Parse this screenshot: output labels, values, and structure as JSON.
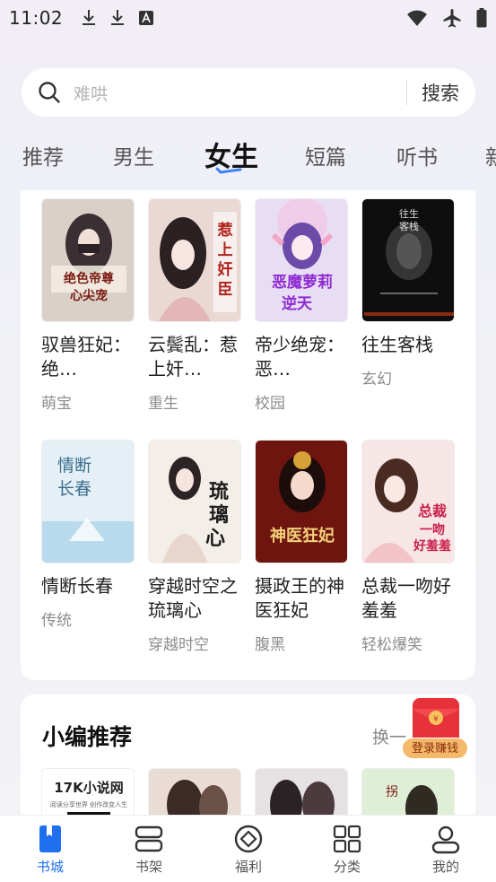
{
  "status_bar": {
    "time": "11:02",
    "left_icons": [
      "download-icon",
      "download-icon",
      "translate-icon"
    ],
    "right_icons": [
      "wifi-icon",
      "airplane-icon",
      "battery-icon"
    ]
  },
  "search": {
    "placeholder": "难哄",
    "button_label": "搜索"
  },
  "tabs": [
    {
      "label": "推荐",
      "active": false
    },
    {
      "label": "男生",
      "active": false
    },
    {
      "label": "女生",
      "active": true
    },
    {
      "label": "短篇",
      "active": false
    },
    {
      "label": "听书",
      "active": false
    },
    {
      "label": "新",
      "active": false
    }
  ],
  "books": [
    {
      "title": "驭兽狂妃：绝…",
      "tag": "萌宝",
      "cover_text": "绝色帝尊心尖宠",
      "cover_color": "#d8d0c6"
    },
    {
      "title": "云鬓乱：惹上奸…",
      "tag": "重生",
      "cover_text": "惹上奸臣",
      "cover_color": "#e8d6d2"
    },
    {
      "title": "帝少绝宠：恶…",
      "tag": "校园",
      "cover_text": "恶魔萝莉逆天",
      "cover_color": "#e7dcf3"
    },
    {
      "title": "往生客栈",
      "tag": "玄幻",
      "cover_text": "往生客栈",
      "cover_color": "#111111"
    },
    {
      "title": "情断长春",
      "tag": "传统",
      "cover_text": "情断长春",
      "cover_color": "#d7e9f3"
    },
    {
      "title": "穿越时空之琉璃心",
      "tag": "穿越时空",
      "cover_text": "琉璃心",
      "cover_color": "#f2ece6"
    },
    {
      "title": "摄政王的神医狂妃",
      "tag": "腹黑",
      "cover_text": "神医狂妃",
      "cover_color": "#7a1a14"
    },
    {
      "title": "总裁一吻好羞羞",
      "tag": "轻松爆笑",
      "cover_text": "总裁一吻好羞羞",
      "cover_color": "#f6e4e4"
    }
  ],
  "editor_section": {
    "title": "小编推荐",
    "refresh_label": "换一",
    "promo_label": "登录赚钱",
    "covers": [
      {
        "text": "17K小说网",
        "sub": "阅读分享世界 创作改变人生",
        "color": "#ffffff"
      },
      {
        "text": "",
        "sub": "",
        "color": "#e9dcd5"
      },
      {
        "text": "",
        "sub": "",
        "color": "#e6e2e4"
      },
      {
        "text": "",
        "sub": "",
        "color": "#e0ecd8"
      }
    ]
  },
  "bottom_nav": [
    {
      "label": "书城",
      "icon": "book-icon",
      "active": true
    },
    {
      "label": "书架",
      "icon": "bookshelf-icon",
      "active": false
    },
    {
      "label": "福利",
      "icon": "gift-icon",
      "active": false
    },
    {
      "label": "分类",
      "icon": "grid-icon",
      "active": false
    },
    {
      "label": "我的",
      "icon": "profile-icon",
      "active": false
    }
  ],
  "colors": {
    "accent": "#1f6fef",
    "tab_indicator": "#3b82f6",
    "tag_text": "#8c8c8c"
  }
}
